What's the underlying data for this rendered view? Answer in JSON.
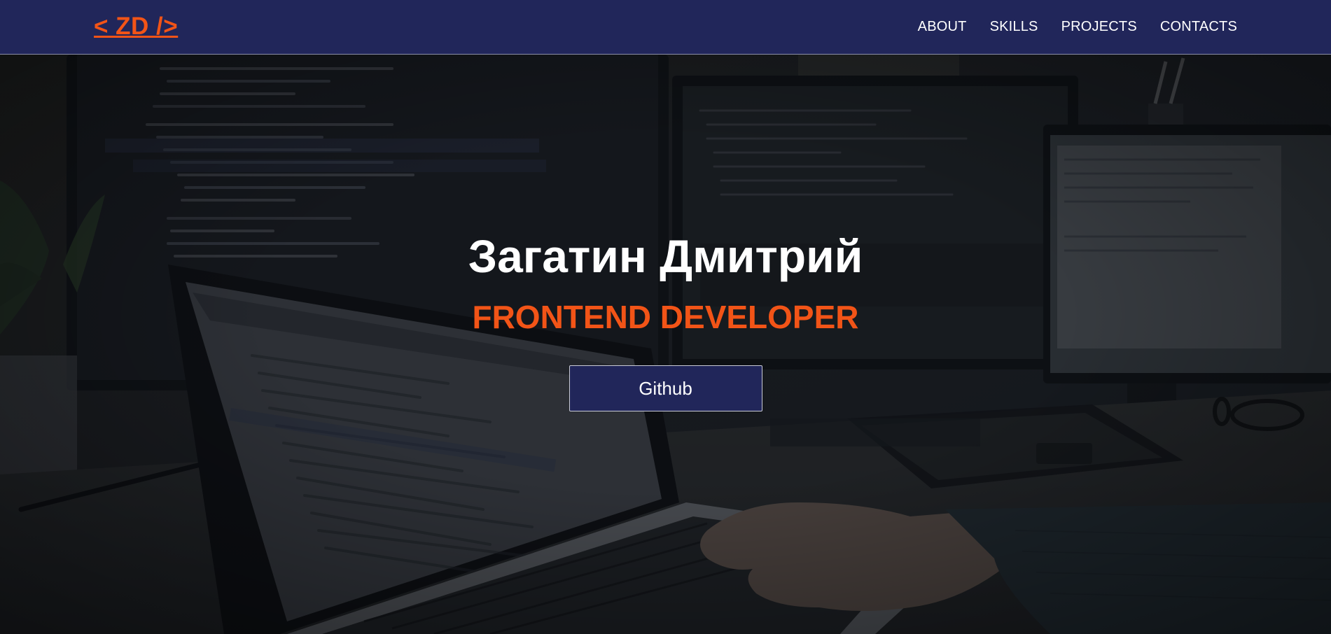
{
  "header": {
    "logo": "< ZD />",
    "nav": [
      {
        "label": "ABOUT"
      },
      {
        "label": "SKILLS"
      },
      {
        "label": "PROJECTS"
      },
      {
        "label": "CONTACTS"
      }
    ]
  },
  "hero": {
    "name": "Загатин Дмитрий",
    "role": "FRONTEND DEVELOPER",
    "button_label": "Github",
    "background": "laptop-and-monitors-code-photo"
  },
  "colors": {
    "header_bg": "#21265a",
    "accent": "#f25417",
    "text": "#ffffff",
    "button_bg": "#21265a"
  }
}
